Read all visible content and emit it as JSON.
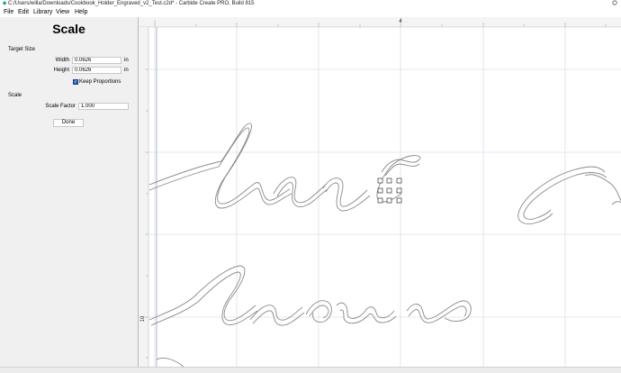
{
  "window": {
    "title": "C:/Users/willa/Downloads/Cookbook_Holder_Engraved_v2_Test.c2d* - Carbide Create PRO, Build 815",
    "app_icon": "carbide-create-icon"
  },
  "menu": {
    "items": [
      "File",
      "Edit",
      "Library",
      "View",
      "Help"
    ]
  },
  "panel": {
    "title": "Scale",
    "target_size": {
      "section_label": "Target Size",
      "width_label": "Width",
      "width_value": "0.0626",
      "width_unit": "in",
      "height_label": "Height",
      "height_value": "0.0626",
      "height_unit": "in",
      "keep_proportions_label": "Keep Proportions",
      "keep_proportions_checked": true
    },
    "scale": {
      "section_label": "Scale",
      "factor_label": "Scale Factor",
      "factor_value": "1.000"
    },
    "done_label": "Done"
  },
  "canvas": {
    "ruler_top_label": "4",
    "ruler_left_label": "10",
    "colors": {
      "grid": "#c9d3e0",
      "ruler": "#d8d8d8",
      "artwork": "#8a8a8a",
      "selection_handle": "#333333"
    }
  }
}
